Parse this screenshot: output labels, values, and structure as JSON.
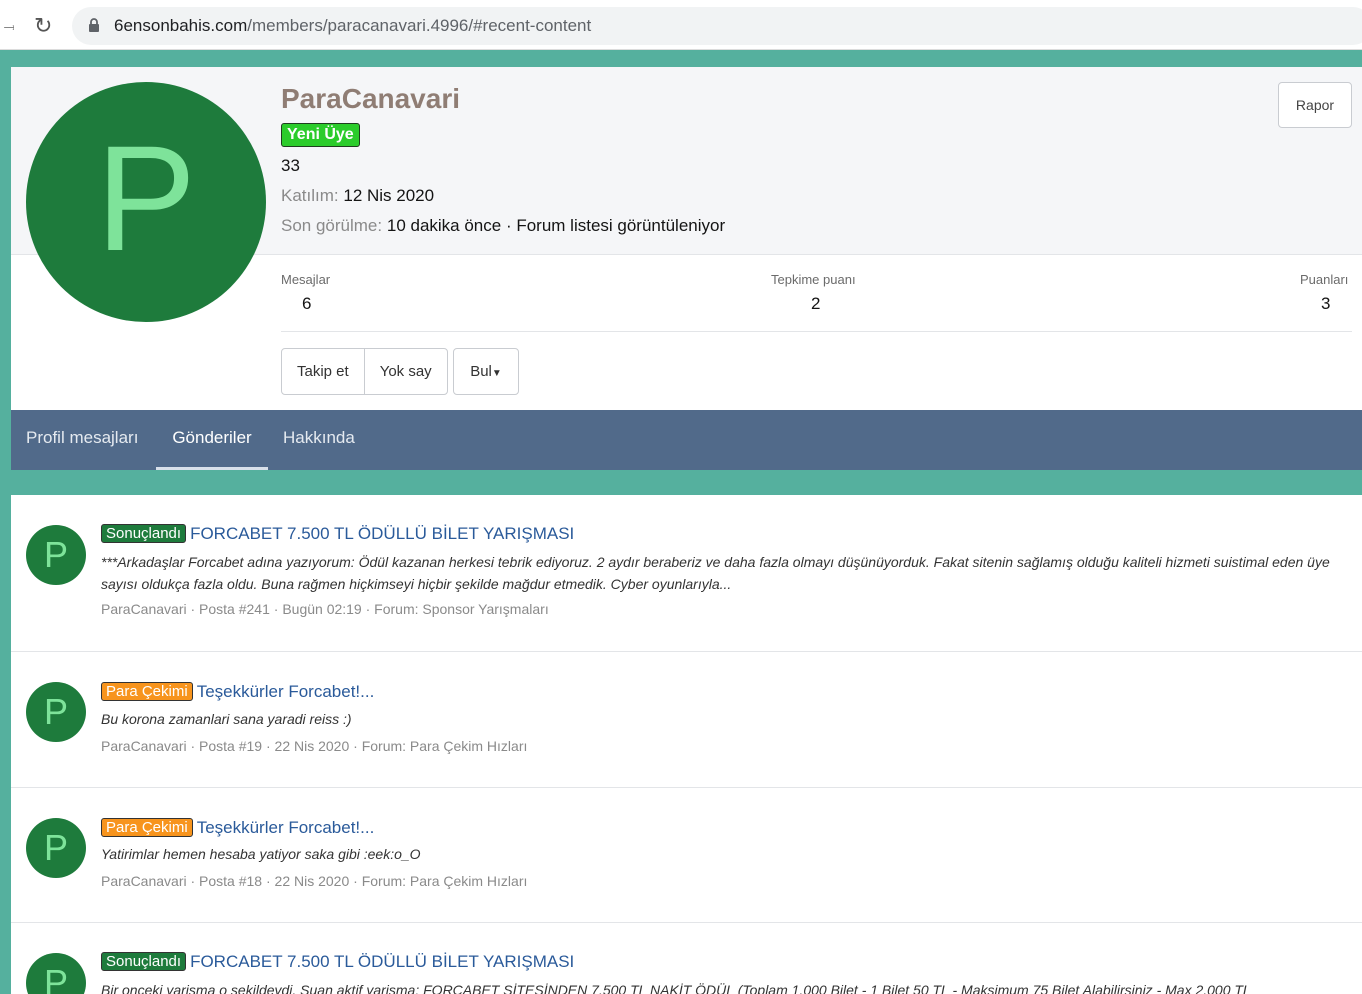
{
  "browser": {
    "url_domain": "6ensonbahis.com",
    "url_path": "/members/paracanavari.4996/#recent-content"
  },
  "profile": {
    "avatar_letter": "P",
    "username": "ParaCanavari",
    "badge": "Yeni Üye",
    "member_number": "33",
    "joined_label": "Katılım:",
    "joined_value": "12 Nis 2020",
    "last_seen_label": "Son görülme:",
    "last_seen_value": "10 dakika önce · Forum listesi görüntüleniyor",
    "report_label": "Rapor",
    "stats": [
      {
        "label": "Mesajlar",
        "value": "6"
      },
      {
        "label": "Tepkime puanı",
        "value": "2"
      },
      {
        "label": "Puanları",
        "value": "3"
      }
    ],
    "buttons": {
      "follow": "Takip et",
      "ignore": "Yok say",
      "find": "Bul"
    }
  },
  "tabs": [
    {
      "label": "Profil mesajları",
      "active": false
    },
    {
      "label": "Gönderiler",
      "active": true
    },
    {
      "label": "Hakkında",
      "active": false
    }
  ],
  "posts": [
    {
      "avatar_letter": "P",
      "label": "Sonuçlandı",
      "title": "FORCABET 7.500 TL ÖDÜLLÜ BİLET YARIŞMASI",
      "snippet": "***Arkadaşlar Forcabet adına yazıyorum: Ödül kazanan herkesi tebrik ediyoruz. 2 aydır beraberiz ve daha fazla olmayı düşünüyorduk. Fakat sitenin sağlamış olduğu kaliteli hizmeti suistimal eden üye sayısı oldukça fazla oldu. Buna rağmen hiçkimseyi hiçbir şekilde mağdur etmedik. Cyber oyunlarıyla...",
      "meta": "ParaCanavari · Posta #241 · Bugün 02:19 · Forum: Sponsor Yarışmaları"
    },
    {
      "avatar_letter": "P",
      "label": "Para Çekimi",
      "title": "Teşekkürler Forcabet!...",
      "snippet": "Bu korona zamanlari sana yaradi reiss :)",
      "meta": "ParaCanavari · Posta #19 · 22 Nis 2020 · Forum: Para Çekim Hızları"
    },
    {
      "avatar_letter": "P",
      "label": "Para Çekimi",
      "title": "Teşekkürler Forcabet!...",
      "snippet": "Yatirimlar hemen hesaba yatiyor saka gibi :eek:o_O",
      "meta": "ParaCanavari · Posta #18 · 22 Nis 2020 · Forum: Para Çekim Hızları"
    },
    {
      "avatar_letter": "P",
      "label": "Sonuçlandı",
      "title": "FORCABET 7.500 TL ÖDÜLLÜ BİLET YARIŞMASI",
      "snippet": "Bir onceki yarisma o sekildeydi. Suan aktif yarisma: FORCABET SİTESİNDEN 7.500 TL NAKİT ÖDÜL (Toplam 1.000 Bilet - 1 Bilet 50 TL - Maksimum 75 Bilet Alabilirsiniz - Max 2.000 TL",
      "meta": ""
    }
  ],
  "colors": {
    "page_bg": "#55b09e",
    "avatar_bg": "#1e7b3c",
    "avatar_letter": "#7ee39a",
    "tab_bar": "#516a8a",
    "link": "#2a5a9a",
    "label_green": "#1e7b3c",
    "label_orange": "#f7941d",
    "badge_new": "#2bcc2b"
  }
}
